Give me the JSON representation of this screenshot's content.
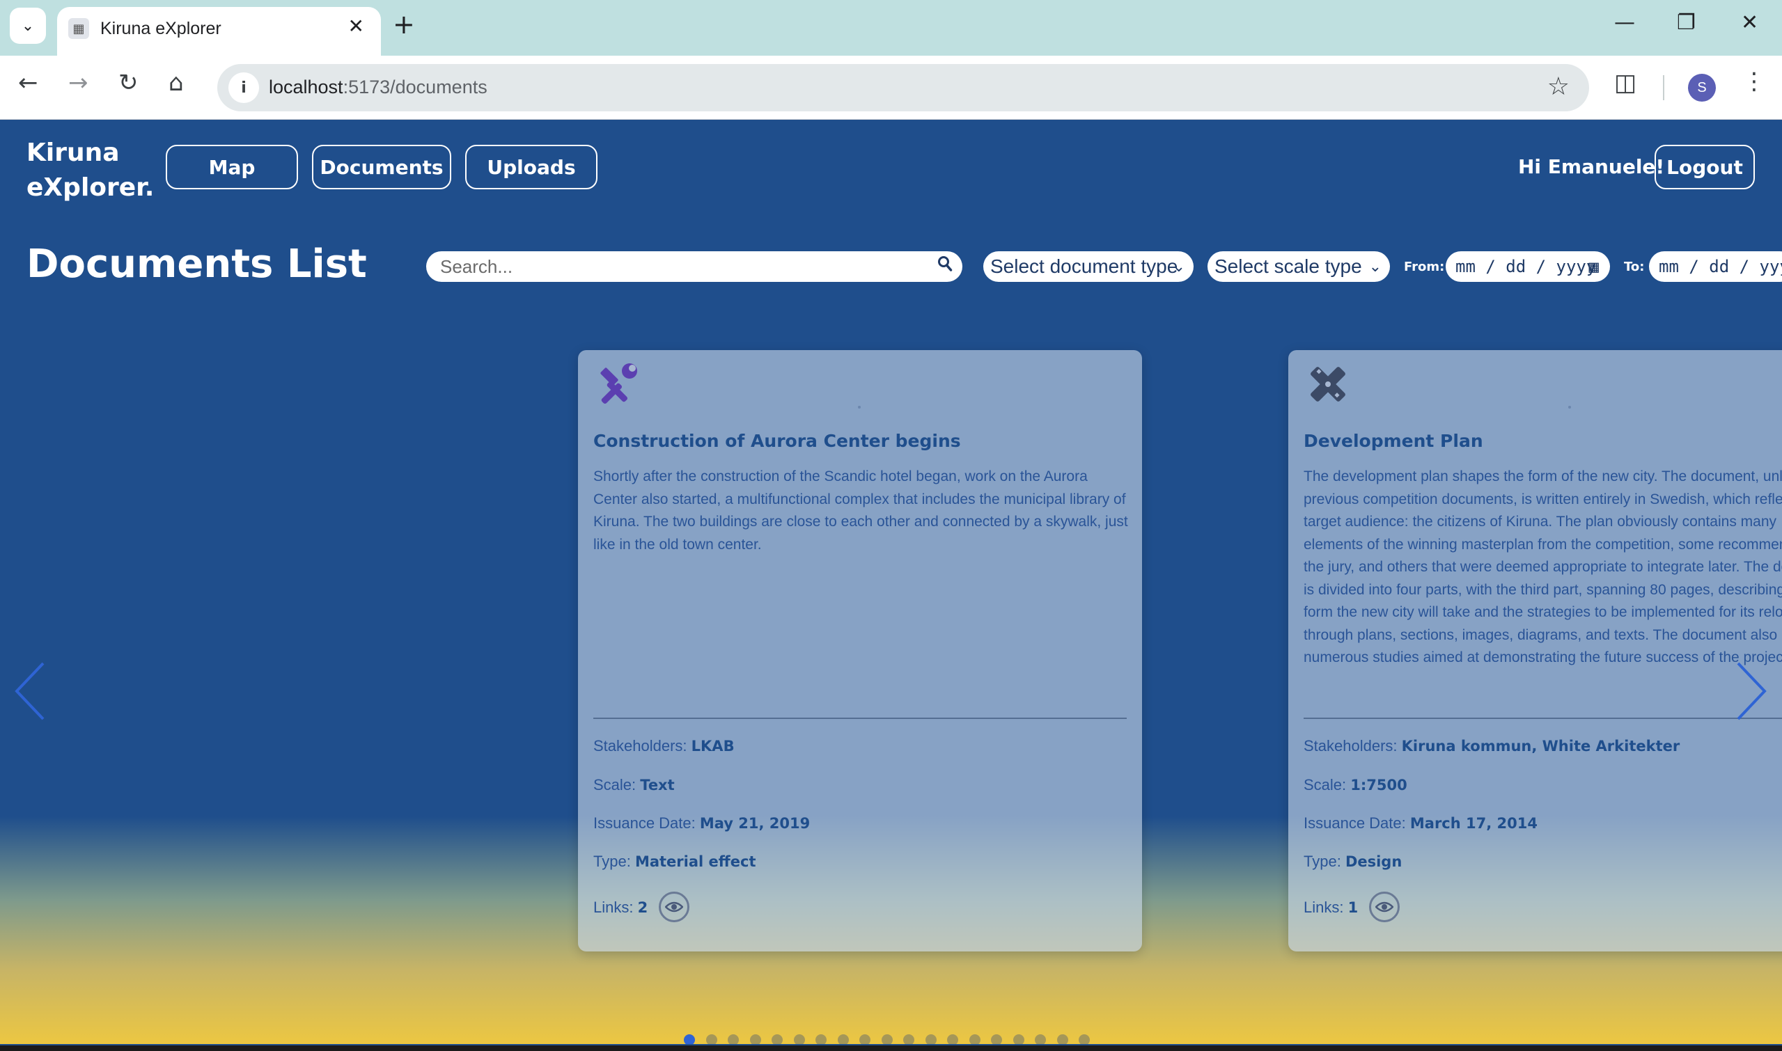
{
  "browser": {
    "tab_title": "Kiruna eXplorer",
    "url_host": "localhost",
    "url_path": ":5173/documents",
    "profile_initial": "S"
  },
  "app": {
    "logo_line1": "Kiruna",
    "logo_line2": "eXplorer.",
    "nav": {
      "map": "Map",
      "documents": "Documents",
      "uploads": "Uploads"
    },
    "greeting": "Hi Emanuele!",
    "logout": "Logout"
  },
  "page": {
    "title": "Documents List",
    "search_placeholder": "Search...",
    "doc_type_select": "Select document type",
    "scale_type_select": "Select scale type",
    "from_label": "From:",
    "to_label": "To:",
    "date_placeholder": "mm / dd / yyyy"
  },
  "cards": [
    {
      "icon": "hammer-wrench-icon",
      "icon_color": "#5b3fb0",
      "title": "Construction of Aurora Center begins",
      "description": "Shortly after the construction of the Scandic hotel began, work on the Aurora Center also started, a multifunctional complex that includes the municipal library of Kiruna. The two buildings are close to each other and connected by a skywalk, just like in the old town center.",
      "stakeholders_label": "Stakeholders:",
      "stakeholders": "LKAB",
      "scale_label": "Scale:",
      "scale": "Text",
      "date_label": "Issuance Date:",
      "date": "May 21, 2019",
      "type_label": "Type:",
      "type": "Material effect",
      "links_label": "Links:",
      "links": "2"
    },
    {
      "icon": "ruler-pencil-icon",
      "icon_color": "#3c4a66",
      "title": "Development Plan",
      "description": "The development plan shapes the form of the new city. The document, unlike previous competition documents, is written entirely in Swedish, which reflects the target audience: the citizens of Kiruna. The plan obviously contains many elements of the winning masterplan from the competition, some recommended by the jury, and others that were deemed appropriate to integrate later. The document is divided into four parts, with the third part, spanning 80 pages, describing the form the new city will take and the strategies to be implemented for its relocation through plans, sections, images, diagrams, and texts. The document also includes numerous studies aimed at demonstrating the future success of the project.",
      "stakeholders_label": "Stakeholders:",
      "stakeholders": "Kiruna kommun, White Arkitekter",
      "scale_label": "Scale:",
      "scale": "1:7500",
      "date_label": "Issuance Date:",
      "date": "March 17, 2014",
      "type_label": "Type:",
      "type": "Design",
      "links_label": "Links:",
      "links": "1"
    }
  ],
  "pagination": {
    "total": 19,
    "active": 1
  },
  "colors": {
    "app_blue": "#1f4e8c",
    "accent_blue": "#2f64d4",
    "gradient_yellow": "#ecc742"
  }
}
